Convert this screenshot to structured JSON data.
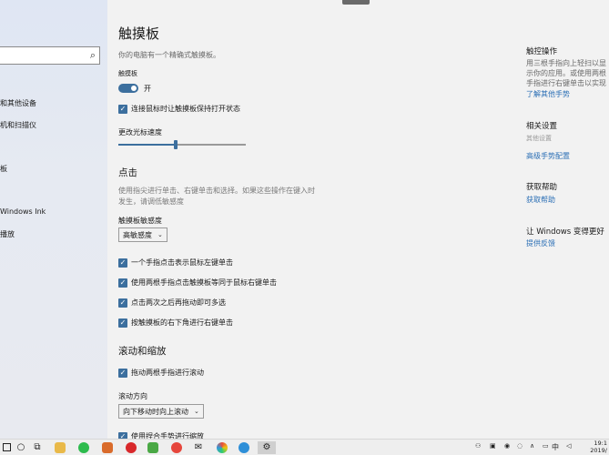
{
  "nav": {
    "items": [
      {
        "label": "和其他设备"
      },
      {
        "label": "机和扫描仪"
      },
      {
        "label": "板"
      },
      {
        "label": "Windows Ink"
      },
      {
        "label": "播放"
      }
    ]
  },
  "main": {
    "title": "触摸板",
    "subtitle": "你的电脑有一个精确式触摸板。",
    "toggle_label": "触摸板",
    "toggle_state": "开",
    "keep_on_mouse": "连接鼠标时让触摸板保持打开状态",
    "cursor_speed_label": "更改光标速度",
    "cursor_speed_value": 0.45,
    "tap_heading": "点击",
    "tap_desc": "使用指尖进行单击、右键单击和选择。如果这些操作在键入时发生，请调低敏感度",
    "sensitivity_label": "触摸板敏感度",
    "sensitivity_value": "高敏感度",
    "tap_options": [
      {
        "label": "一个手指点击表示鼠标左键单击"
      },
      {
        "label": "使用两根手指点击触摸板等同于鼠标右键单击"
      },
      {
        "label": "点击两次之后再拖动即可多选"
      },
      {
        "label": "按触摸板的右下角进行右键单击"
      }
    ],
    "scroll_heading": "滚动和缩放",
    "drag_scroll": "拖动两根手指进行滚动",
    "scroll_dir_label": "滚动方向",
    "scroll_dir_value": "向下移动时向上滚动",
    "pinch_zoom": "使用捏合手势进行缩放"
  },
  "right": {
    "touch_heading": "触控操作",
    "touch_desc": "用三根手指向上轻扫以显示你的应用。或使用两根手指进行右键单击以实现右键单击效果。",
    "touch_link": "了解其他手势",
    "related_heading": "相关设置",
    "related_item": "其他设置",
    "related_link": "高级手势配置",
    "help_heading": "获取帮助",
    "help_link": "获取帮助",
    "better_heading": "让 Windows 变得更好",
    "better_link": "提供反馈"
  },
  "taskbar": {
    "ime": "中",
    "time": "19:1",
    "date": "2019/"
  }
}
